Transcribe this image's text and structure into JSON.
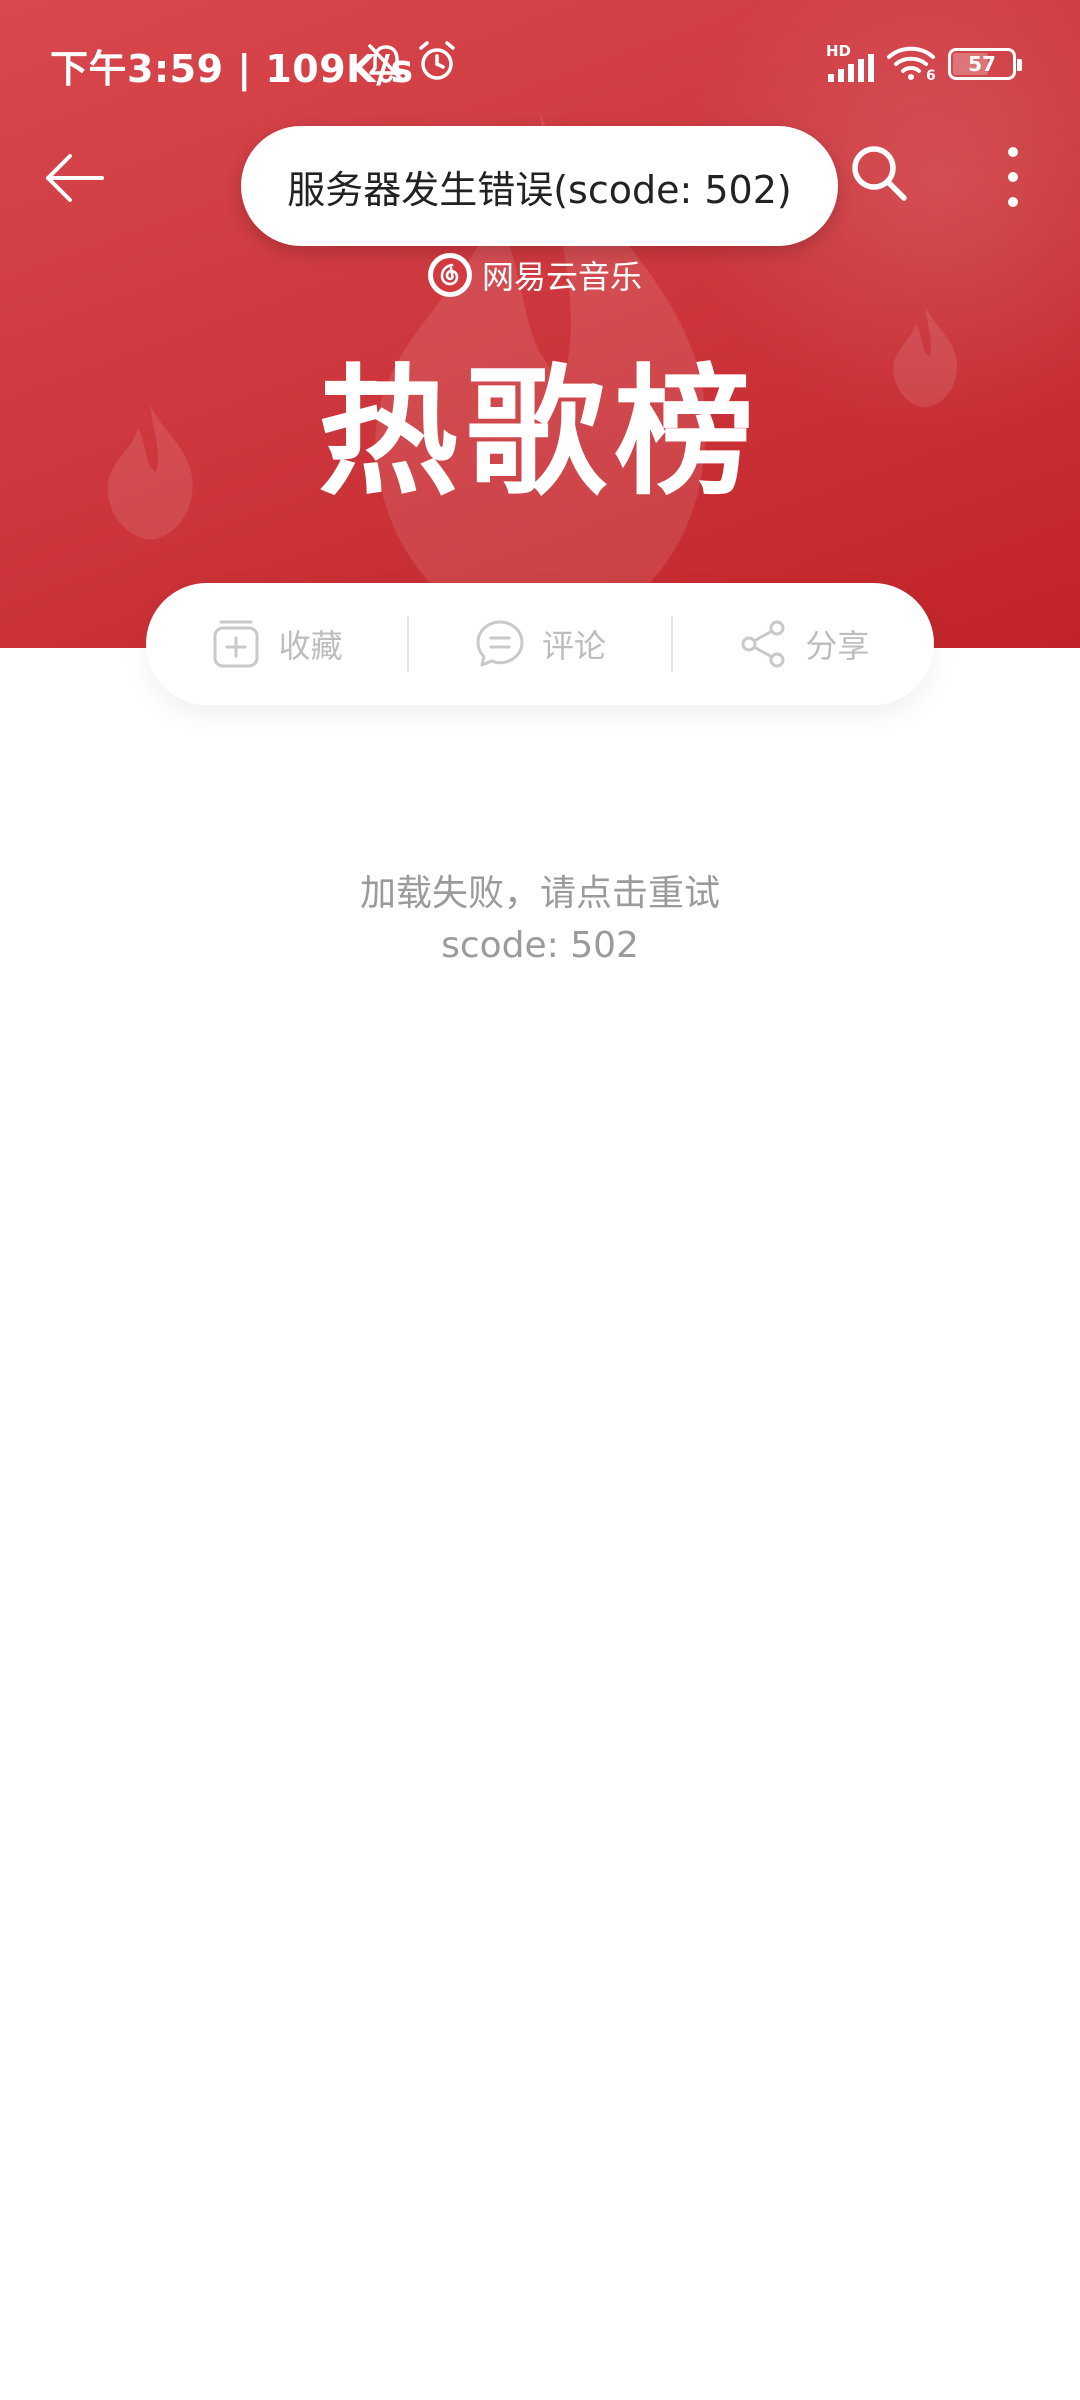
{
  "status_bar": {
    "time": "下午3:59 | 109K/s",
    "signal_label": "HD",
    "wifi_sub": "6",
    "battery": "57"
  },
  "toast": {
    "message": "服务器发生错误(scode: 502)"
  },
  "header": {
    "brand_name": "网易云音乐",
    "title": "热歌榜"
  },
  "actions": [
    {
      "label": "收藏",
      "icon": "add-collect-icon"
    },
    {
      "label": "评论",
      "icon": "comment-icon"
    },
    {
      "label": "分享",
      "icon": "share-icon"
    }
  ],
  "error": {
    "line1": "加载失败，请点击重试",
    "line2": "scode: 502"
  },
  "colors": {
    "header_red": "#cf3a40",
    "muted_text": "#9b9b9b",
    "icon_gray": "#bdbdbd"
  }
}
